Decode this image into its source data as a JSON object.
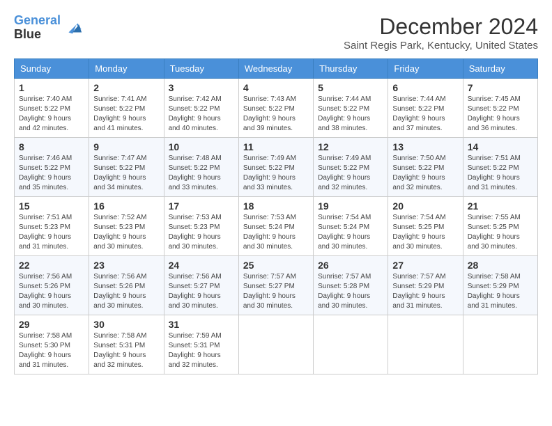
{
  "logo": {
    "line1": "General",
    "line2": "Blue"
  },
  "title": "December 2024",
  "location": "Saint Regis Park, Kentucky, United States",
  "headers": [
    "Sunday",
    "Monday",
    "Tuesday",
    "Wednesday",
    "Thursday",
    "Friday",
    "Saturday"
  ],
  "weeks": [
    [
      {
        "day": "1",
        "sunrise": "7:40 AM",
        "sunset": "5:22 PM",
        "daylight": "9 hours and 42 minutes."
      },
      {
        "day": "2",
        "sunrise": "7:41 AM",
        "sunset": "5:22 PM",
        "daylight": "9 hours and 41 minutes."
      },
      {
        "day": "3",
        "sunrise": "7:42 AM",
        "sunset": "5:22 PM",
        "daylight": "9 hours and 40 minutes."
      },
      {
        "day": "4",
        "sunrise": "7:43 AM",
        "sunset": "5:22 PM",
        "daylight": "9 hours and 39 minutes."
      },
      {
        "day": "5",
        "sunrise": "7:44 AM",
        "sunset": "5:22 PM",
        "daylight": "9 hours and 38 minutes."
      },
      {
        "day": "6",
        "sunrise": "7:44 AM",
        "sunset": "5:22 PM",
        "daylight": "9 hours and 37 minutes."
      },
      {
        "day": "7",
        "sunrise": "7:45 AM",
        "sunset": "5:22 PM",
        "daylight": "9 hours and 36 minutes."
      }
    ],
    [
      {
        "day": "8",
        "sunrise": "7:46 AM",
        "sunset": "5:22 PM",
        "daylight": "9 hours and 35 minutes."
      },
      {
        "day": "9",
        "sunrise": "7:47 AM",
        "sunset": "5:22 PM",
        "daylight": "9 hours and 34 minutes."
      },
      {
        "day": "10",
        "sunrise": "7:48 AM",
        "sunset": "5:22 PM",
        "daylight": "9 hours and 33 minutes."
      },
      {
        "day": "11",
        "sunrise": "7:49 AM",
        "sunset": "5:22 PM",
        "daylight": "9 hours and 33 minutes."
      },
      {
        "day": "12",
        "sunrise": "7:49 AM",
        "sunset": "5:22 PM",
        "daylight": "9 hours and 32 minutes."
      },
      {
        "day": "13",
        "sunrise": "7:50 AM",
        "sunset": "5:22 PM",
        "daylight": "9 hours and 32 minutes."
      },
      {
        "day": "14",
        "sunrise": "7:51 AM",
        "sunset": "5:22 PM",
        "daylight": "9 hours and 31 minutes."
      }
    ],
    [
      {
        "day": "15",
        "sunrise": "7:51 AM",
        "sunset": "5:23 PM",
        "daylight": "9 hours and 31 minutes."
      },
      {
        "day": "16",
        "sunrise": "7:52 AM",
        "sunset": "5:23 PM",
        "daylight": "9 hours and 30 minutes."
      },
      {
        "day": "17",
        "sunrise": "7:53 AM",
        "sunset": "5:23 PM",
        "daylight": "9 hours and 30 minutes."
      },
      {
        "day": "18",
        "sunrise": "7:53 AM",
        "sunset": "5:24 PM",
        "daylight": "9 hours and 30 minutes."
      },
      {
        "day": "19",
        "sunrise": "7:54 AM",
        "sunset": "5:24 PM",
        "daylight": "9 hours and 30 minutes."
      },
      {
        "day": "20",
        "sunrise": "7:54 AM",
        "sunset": "5:25 PM",
        "daylight": "9 hours and 30 minutes."
      },
      {
        "day": "21",
        "sunrise": "7:55 AM",
        "sunset": "5:25 PM",
        "daylight": "9 hours and 30 minutes."
      }
    ],
    [
      {
        "day": "22",
        "sunrise": "7:56 AM",
        "sunset": "5:26 PM",
        "daylight": "9 hours and 30 minutes."
      },
      {
        "day": "23",
        "sunrise": "7:56 AM",
        "sunset": "5:26 PM",
        "daylight": "9 hours and 30 minutes."
      },
      {
        "day": "24",
        "sunrise": "7:56 AM",
        "sunset": "5:27 PM",
        "daylight": "9 hours and 30 minutes."
      },
      {
        "day": "25",
        "sunrise": "7:57 AM",
        "sunset": "5:27 PM",
        "daylight": "9 hours and 30 minutes."
      },
      {
        "day": "26",
        "sunrise": "7:57 AM",
        "sunset": "5:28 PM",
        "daylight": "9 hours and 30 minutes."
      },
      {
        "day": "27",
        "sunrise": "7:57 AM",
        "sunset": "5:29 PM",
        "daylight": "9 hours and 31 minutes."
      },
      {
        "day": "28",
        "sunrise": "7:58 AM",
        "sunset": "5:29 PM",
        "daylight": "9 hours and 31 minutes."
      }
    ],
    [
      {
        "day": "29",
        "sunrise": "7:58 AM",
        "sunset": "5:30 PM",
        "daylight": "9 hours and 31 minutes."
      },
      {
        "day": "30",
        "sunrise": "7:58 AM",
        "sunset": "5:31 PM",
        "daylight": "9 hours and 32 minutes."
      },
      {
        "day": "31",
        "sunrise": "7:59 AM",
        "sunset": "5:31 PM",
        "daylight": "9 hours and 32 minutes."
      },
      null,
      null,
      null,
      null
    ]
  ]
}
